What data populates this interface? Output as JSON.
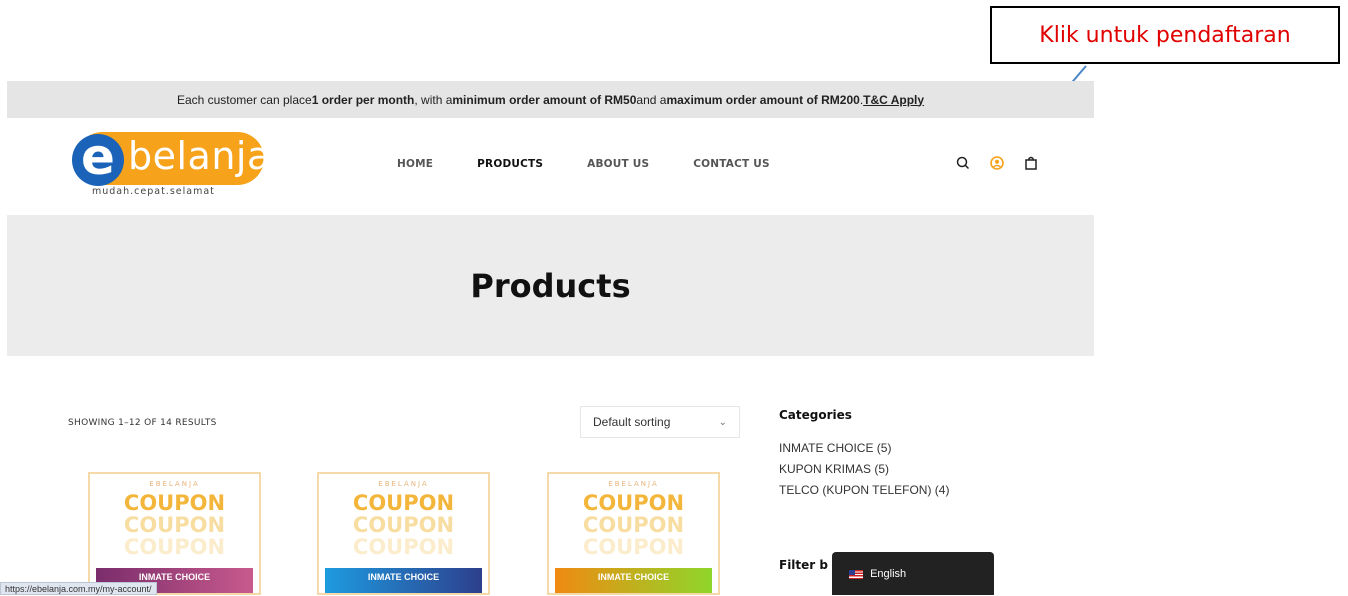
{
  "annotation": {
    "callout_text": "Klik untuk pendaftaran"
  },
  "promo_bar": {
    "part1": "Each customer can place ",
    "bold1": "1 order per month",
    "part2": ", with a ",
    "bold2": "minimum order amount of RM50",
    "part3": " and a ",
    "bold3": "maximum order amount of RM200",
    "part4": ". ",
    "link": "T&C Apply"
  },
  "logo": {
    "letter": "e",
    "word": "belanja",
    "tagline": "mudah.cepat.selamat"
  },
  "nav": {
    "items": [
      "HOME",
      "PRODUCTS",
      "ABOUT US",
      "CONTACT US"
    ],
    "active": "PRODUCTS"
  },
  "header_icons": [
    "search-icon",
    "account-icon",
    "cart-icon"
  ],
  "accent_color": "#f7a21b",
  "hero": {
    "title": "Products"
  },
  "shop": {
    "result_count": "SHOWING 1–12 OF 14 RESULTS",
    "sorting": "Default sorting"
  },
  "products": [
    {
      "brand": "EBELANJA",
      "line": "COUPON",
      "band": "INMATE CHOICE"
    },
    {
      "brand": "EBELANJA",
      "line": "COUPON",
      "band": "INMATE CHOICE"
    },
    {
      "brand": "EBELANJA",
      "line": "COUPON",
      "band": "INMATE CHOICE"
    }
  ],
  "sidebar": {
    "categories_title": "Categories",
    "categories": [
      "INMATE CHOICE (5)",
      "KUPON KRIMAS (5)",
      "TELCO (KUPON TELEFON) (4)"
    ],
    "filter_title": "Filter b"
  },
  "language_switcher": {
    "label": "English"
  },
  "status_bar": {
    "url": "https://ebelanja.com.my/my-account/"
  }
}
